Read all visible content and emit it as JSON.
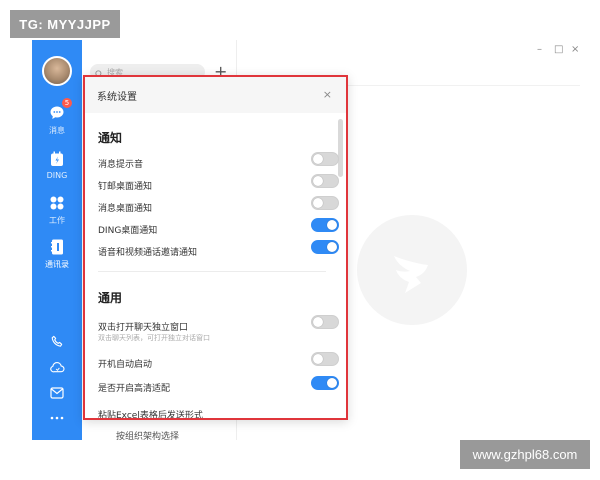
{
  "watermarks": {
    "top_left": "TG: MYYJJPP",
    "bottom_right": "www.gzhpl68.com"
  },
  "sidebar": {
    "items": [
      {
        "label": "消息",
        "badge": "5"
      },
      {
        "label": "DING"
      },
      {
        "label": "工作"
      },
      {
        "label": "通讯录"
      }
    ]
  },
  "list_panel": {
    "search_placeholder": "搜索",
    "add_label": "+",
    "tail_text": "按组织架构选择"
  },
  "window_controls": {
    "minimize": "–",
    "maximize": "□",
    "close": "×"
  },
  "dialog": {
    "title": "系统设置",
    "close_label": "×",
    "sections": [
      {
        "title": "通知",
        "settings": [
          {
            "label": "消息提示音",
            "enabled": false
          },
          {
            "label": "钉邮桌面通知",
            "enabled": false
          },
          {
            "label": "消息桌面通知",
            "enabled": false
          },
          {
            "label": "DING桌面通知",
            "enabled": true
          },
          {
            "label": "语音和视频通话邀请通知",
            "enabled": true
          }
        ]
      },
      {
        "title": "通用",
        "settings": [
          {
            "label": "双击打开聊天独立窗口",
            "sub": "双击聊天列表，可打开独立对话窗口",
            "enabled": false
          },
          {
            "label": "开机自动启动",
            "enabled": false
          },
          {
            "label": "是否开启高清适配",
            "enabled": true
          },
          {
            "label": "粘贴Excel表格后发送形式"
          }
        ]
      }
    ]
  },
  "colors": {
    "brand_blue": "#2f8af5",
    "highlight_red": "#e0353b",
    "badge_red": "#ff5a4a"
  }
}
